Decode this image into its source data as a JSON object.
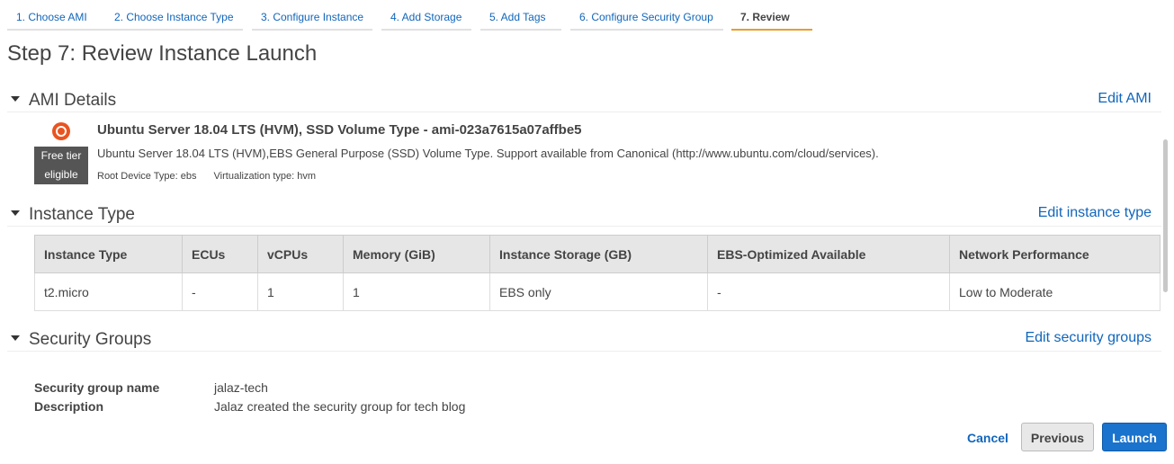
{
  "wizard": {
    "steps": [
      {
        "label": "1. Choose AMI"
      },
      {
        "label": "2. Choose Instance Type"
      },
      {
        "label": "3. Configure Instance"
      },
      {
        "label": "4. Add Storage"
      },
      {
        "label": "5. Add Tags"
      },
      {
        "label": "6. Configure Security Group"
      },
      {
        "label": "7. Review",
        "active": true
      }
    ]
  },
  "page": {
    "title": "Step 7: Review Instance Launch"
  },
  "ami_details": {
    "title": "AMI Details",
    "edit_label": "Edit AMI",
    "icon": "ubuntu-logo-icon",
    "badge_line1": "Free tier",
    "badge_line2": "eligible",
    "name": "Ubuntu Server 18.04 LTS (HVM), SSD Volume Type - ami-023a7615a07affbe5",
    "description": "Ubuntu Server 18.04 LTS (HVM),EBS General Purpose (SSD) Volume Type. Support available from Canonical (http://www.ubuntu.com/cloud/services).",
    "root_device": "Root Device Type: ebs",
    "virtualization": "Virtualization type: hvm"
  },
  "instance_type": {
    "title": "Instance Type",
    "edit_label": "Edit instance type",
    "headers": [
      "Instance Type",
      "ECUs",
      "vCPUs",
      "Memory (GiB)",
      "Instance Storage (GB)",
      "EBS-Optimized Available",
      "Network Performance"
    ],
    "row": [
      "t2.micro",
      "-",
      "1",
      "1",
      "EBS only",
      "-",
      "Low to Moderate"
    ]
  },
  "security_groups": {
    "title": "Security Groups",
    "edit_label": "Edit security groups",
    "name_label": "Security group name",
    "name_value": "jalaz-tech",
    "desc_label": "Description",
    "desc_value": "Jalaz created the security group for tech blog"
  },
  "footer": {
    "cancel": "Cancel",
    "previous": "Previous",
    "launch": "Launch"
  },
  "colors": {
    "accent": "#eb9d2c",
    "link": "#1166bb",
    "primary_button": "#1a73cc"
  }
}
